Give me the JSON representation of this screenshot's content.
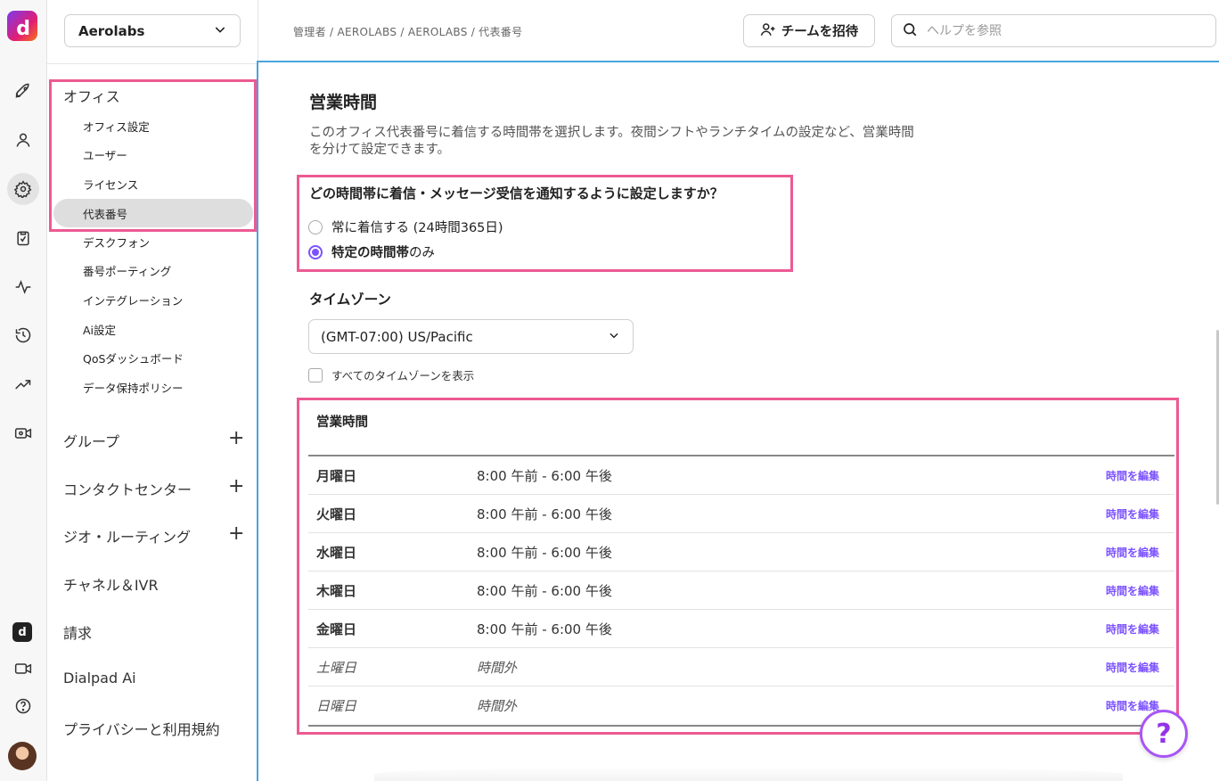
{
  "app": {
    "logo_letter": "d",
    "mini_logo_letter": "d"
  },
  "rail": {
    "icons": [
      "rocket-icon",
      "person-icon",
      "gear-icon",
      "clipboard-icon",
      "activity-icon",
      "history-icon",
      "trending-icon",
      "video-settings-icon",
      "dialpad-ai-icon",
      "video-icon",
      "help-circle-icon"
    ]
  },
  "sidebar": {
    "org_select": "Aerolabs",
    "office_section": "オフィス",
    "office_items": [
      "オフィス設定",
      "ユーザー",
      "ライセンス",
      "代表番号",
      "デスクフォン",
      "番号ポーティング",
      "インテグレーション",
      "Ai設定",
      "QoSダッシュボード",
      "データ保持ポリシー"
    ],
    "active_item": "代表番号",
    "sections": [
      "グループ",
      "コンタクトセンター",
      "ジオ・ルーティング",
      "チャネル＆IVR",
      "請求",
      "Dialpad Ai",
      "プライバシーと利用規約"
    ]
  },
  "topbar": {
    "breadcrumb": "管理者 / AEROLABS / AEROLABS / 代表番号",
    "invite_label": "チームを招待",
    "search_placeholder": "ヘルプを参照"
  },
  "main": {
    "title": "営業時間",
    "description": "このオフィス代表番号に着信する時間帯を選択します。夜間シフトやランチタイムの設定など、営業時間を分けて設定できます。",
    "question": "どの時間帯に着信・メッセージ受信を通知するように設定しますか？",
    "option_always": "常に着信する (24時間365日)",
    "option_specific_bold": "特定の時間帯",
    "option_specific_rest": "のみ",
    "selected_option": "特定の時間帯のみ",
    "timezone_label": "タイムゾーン",
    "timezone_value": "(GMT-07:00) US/Pacific",
    "show_all_timezones": "すべてのタイムゾーンを表示",
    "hours_title": "営業時間",
    "edit_label": "時間を編集",
    "hours": [
      {
        "day": "月曜日",
        "time": "8:00 午前 - 6:00 午後",
        "open": true
      },
      {
        "day": "火曜日",
        "time": "8:00 午前 - 6:00 午後",
        "open": true
      },
      {
        "day": "水曜日",
        "time": "8:00 午前 - 6:00 午後",
        "open": true
      },
      {
        "day": "木曜日",
        "time": "8:00 午前 - 6:00 午後",
        "open": true
      },
      {
        "day": "金曜日",
        "time": "8:00 午前 - 6:00 午後",
        "open": true
      },
      {
        "day": "土曜日",
        "time": "時間外",
        "open": false
      },
      {
        "day": "日曜日",
        "time": "時間外",
        "open": false
      }
    ]
  },
  "colors": {
    "accent": "#7c52ff",
    "highlight": "#ec5a92",
    "focus_border": "#4aa3df"
  },
  "help_fab": "?"
}
